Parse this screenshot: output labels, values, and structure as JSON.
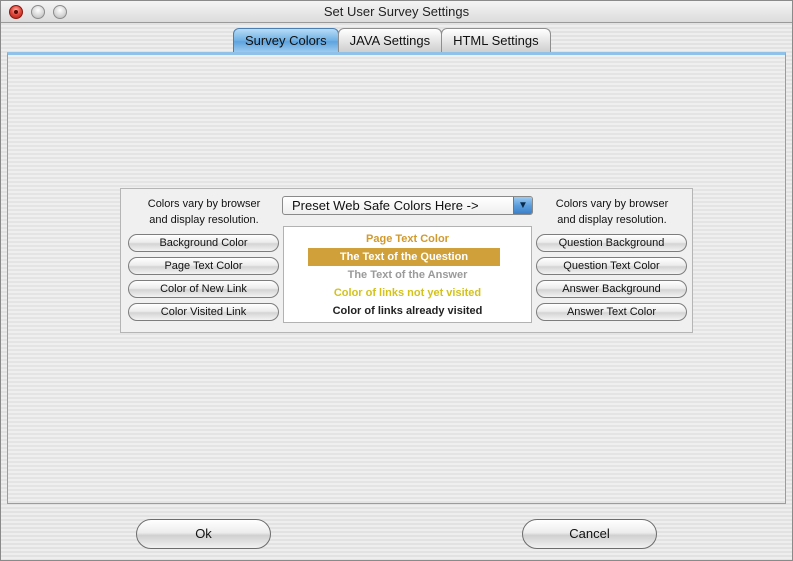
{
  "window": {
    "title": "Set User Survey Settings"
  },
  "tabs": [
    {
      "label": "Survey Colors",
      "active": true
    },
    {
      "label": "JAVA Settings",
      "active": false
    },
    {
      "label": "HTML Settings",
      "active": false
    }
  ],
  "panel": {
    "left_hint": "Colors vary by browser\nand display resolution.",
    "right_hint": "Colors vary by browser\nand display resolution.",
    "preset_select": {
      "value": "Preset Web Safe Colors Here ->",
      "arrow_icon": "chevron-down-icon"
    },
    "left_buttons": [
      "Background Color",
      "Page Text Color",
      "Color of New Link",
      "Color Visited Link"
    ],
    "right_buttons": [
      "Question Background",
      "Question Text Color",
      "Answer Background",
      "Answer Text Color"
    ],
    "preview": {
      "page_text": "Page Text Color",
      "question": "The Text of the Question",
      "answer": "The Text of the Answer",
      "new_link": "Color of links not yet visited",
      "visited_link": "Color of links already visited"
    }
  },
  "footer": {
    "ok_label": "Ok",
    "cancel_label": "Cancel"
  },
  "colors": {
    "page_text": "#d19a2e",
    "question_bg": "#d0a13b",
    "question_text": "#ffffff",
    "answer_text": "#9a9a9a",
    "new_link": "#d4c21a",
    "visited_link": "#222222",
    "active_tab": "#6fb1e6"
  }
}
